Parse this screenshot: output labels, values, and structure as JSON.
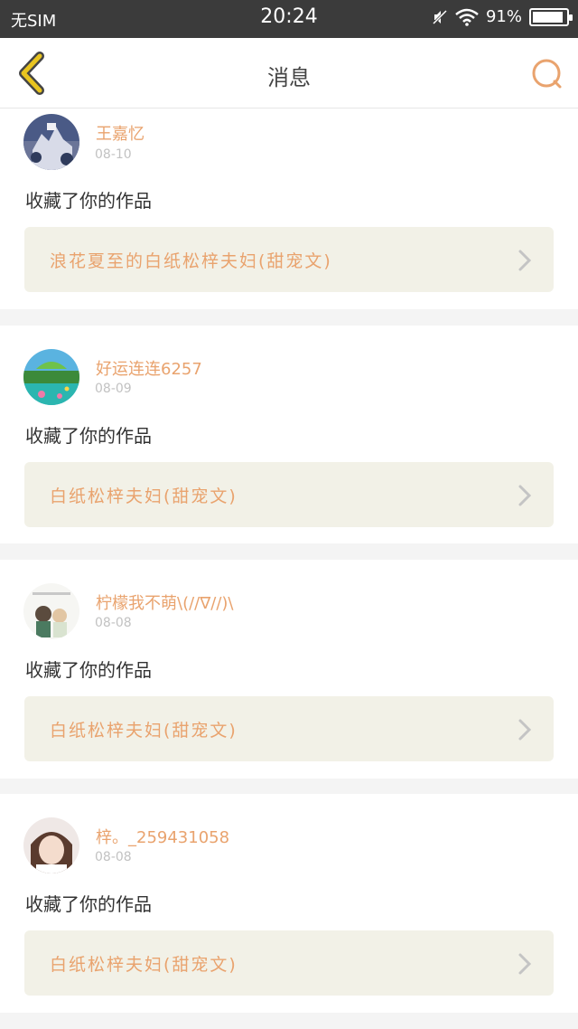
{
  "status_bar": {
    "carrier": "无SIM",
    "time": "20:24",
    "battery": "91%",
    "battery_level": 0.91
  },
  "header": {
    "title": "消息",
    "back_icon": "back-chevron-icon",
    "search_icon": "search-icon",
    "accent_color": "#e9a36e",
    "back_color": "#e8c420"
  },
  "messages": [
    {
      "user": "王嘉忆",
      "date": "08-10",
      "action": "收藏了你的作品",
      "work_title": "浪花夏至的白纸松梓夫妇(甜宠文)"
    },
    {
      "user": "好运连连6257",
      "date": "08-09",
      "action": "收藏了你的作品",
      "work_title": "白纸松梓夫妇(甜宠文)"
    },
    {
      "user": "柠檬我不萌\\(//∇//)\\",
      "date": "08-08",
      "action": "收藏了你的作品",
      "work_title": "白纸松梓夫妇(甜宠文)"
    },
    {
      "user": "梓。_259431058",
      "date": "08-08",
      "action": "收藏了你的作品",
      "work_title": "白纸松梓夫妇(甜宠文)"
    }
  ]
}
